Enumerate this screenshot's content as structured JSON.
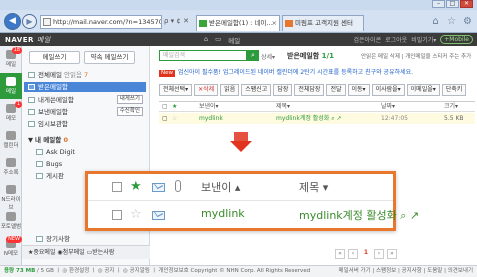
{
  "browser": {
    "url": "http://mail.naver.com/?n=13457015071808v=f#%",
    "url_controls": "ρ ▾ ¢ ✕",
    "tabs": [
      {
        "label": "받은메일함(1) : 네이…",
        "active": true
      },
      {
        "label": "미림프 고객지원 센터",
        "active": false
      }
    ],
    "window_buttons": [
      "–",
      "□",
      "✕"
    ]
  },
  "gnb": {
    "logo": "NAVER",
    "logo_sub": "메일",
    "center_items": [
      "⌂",
      "▭",
      "메일"
    ],
    "right_items": [
      "검은아이콘",
      "로그아웃",
      "비밀기기▾"
    ],
    "mobile": "+Mobile"
  },
  "left_bar": [
    {
      "label": "메일",
      "count": "18"
    },
    {
      "label": "메일",
      "count": ""
    },
    {
      "label": "메모",
      "count": "1"
    },
    {
      "label": "캘린더",
      "count": ""
    },
    {
      "label": "주소록",
      "count": ""
    },
    {
      "label": "N드라이브",
      "count": ""
    },
    {
      "label": "포토앨범",
      "count": ""
    },
    {
      "label": "N메모",
      "count": ""
    },
    {
      "label": "새 아이콘",
      "count": "NEW"
    }
  ],
  "folders": {
    "write_button": "메일쓰기",
    "self_button": "약속 메일쓰기",
    "items": [
      {
        "label": "전체메일",
        "extra": "안읽음",
        "num": "7"
      },
      {
        "label": "받은메일함",
        "extra": "",
        "num": ""
      },
      {
        "label": "내게쓴메일함",
        "extra": "",
        "num": "",
        "tag": "내게쓰기"
      },
      {
        "label": "보낸메일함",
        "extra": "",
        "num": "",
        "tag": "수신확인"
      },
      {
        "label": "임시보관함",
        "extra": "",
        "num": ""
      },
      {
        "label": "내 메일함",
        "extra": "",
        "num": "0"
      },
      {
        "label": "Ask Digit",
        "extra": "",
        "num": ""
      },
      {
        "label": "Bugs",
        "extra": "",
        "num": ""
      },
      {
        "label": "게시판",
        "extra": "",
        "num": ""
      },
      {
        "label": "장기사항",
        "extra": "",
        "num": ""
      }
    ],
    "bottom": "★중요메일 ◉첨부메일 ▭받는사람"
  },
  "main": {
    "search_placeholder": "메일검색",
    "search_detail": "상세▾",
    "inbox_title": "받은메일함",
    "inbox_count": "1/1",
    "top_links": "안읽은 메일 삭제 | 개인메일을 스티커 주는 추가",
    "notice_badge": "New",
    "notice_text": "업신아이 필수품! 업그레이드된 네이버 캘린더에 2탄기 시간표를 등록하고 친구와 공유하세요.",
    "toolbar": [
      "전체선택▾",
      "✕삭제",
      "읽음",
      "스팸신고",
      "답장",
      "전체답장",
      "전달",
      "이동▾",
      "이사람을▾",
      "이메일을▾",
      "단축키"
    ],
    "list_head": {
      "sender": "보낸이▾",
      "subject": "제목▾",
      "date": "날짜▾",
      "size": "크기▾"
    },
    "row": {
      "sender": "mydlink",
      "subject": "mydlink계정 활성화 ⌕ ↗",
      "date": "12:47:05",
      "size": "5.5 KB"
    }
  },
  "zoom": {
    "header_sender": "보낸이 ▴",
    "header_subject": "제목 ▾",
    "sender": "mydlink",
    "subject": "mydlink계정 활성화 ⌕ ↗"
  },
  "pager": {
    "prev2": "«",
    "prev": "‹",
    "current": "1",
    "next": "›",
    "next2": "»"
  },
  "status": {
    "used": "용량 73 MB",
    "rest": " / 5 GB ㅣ ◎ 환경설정 ㅣ ◎ 공지 ㅣ ◎ 공지알림 ㅣ 개인정보보호 Copyright © NHN Corp. All Rights Reserved",
    "right": "메일서버 가기 | 스팸정보 | 공지사항 | 도움말 | 의견보내기"
  },
  "colors": {
    "accent": "#2d9b3c",
    "highlight": "#e8762c",
    "arrow": "#e0341e",
    "selected": "#4a86d8"
  }
}
